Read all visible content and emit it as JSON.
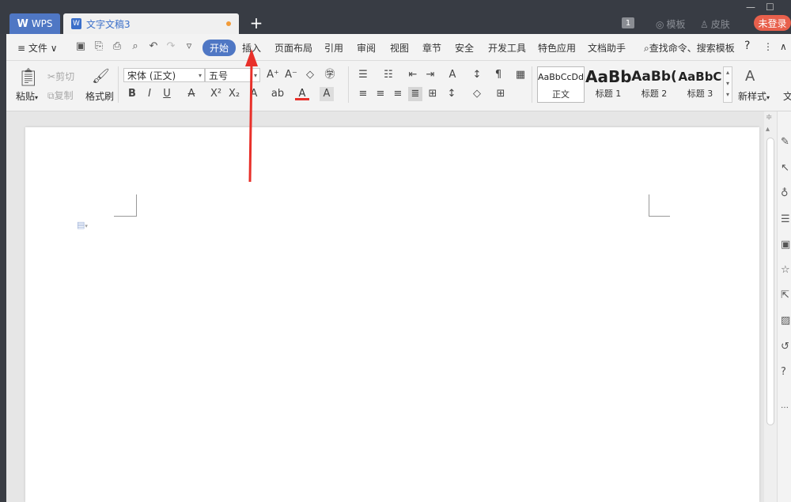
{
  "titlebar": {
    "wps_tab": "WPS",
    "doc_tab": "文字文稿3",
    "num_badge": "1",
    "template_link": "模板",
    "skin_link": "皮肤",
    "login_button": "未登录"
  },
  "menubar": {
    "file": "文件",
    "items": [
      "开始",
      "插入",
      "页面布局",
      "引用",
      "审阅",
      "视图",
      "章节",
      "安全",
      "开发工具",
      "特色应用",
      "文档助手"
    ],
    "search": "查找命令、搜索模板",
    "help": "?"
  },
  "ribbon": {
    "paste": "粘贴",
    "cut": "剪切",
    "copy": "复制",
    "format_painter": "格式刷",
    "font_name": "宋体 (正文)",
    "font_size": "五号",
    "styles": [
      {
        "preview": "AaBbCcDd",
        "label": "正文"
      },
      {
        "preview": "AaBb",
        "label": "标题 1"
      },
      {
        "preview": "AaBb(",
        "label": "标题 2"
      },
      {
        "preview": "AaBbC",
        "label": "标题 3"
      }
    ],
    "new_style": "新样式",
    "more_text": "文"
  },
  "annotation": {
    "arrow_color": "#e8302a"
  },
  "colors": {
    "accent": "#4f77c4",
    "login": "#e8604c",
    "titlebar": "#383c44"
  }
}
